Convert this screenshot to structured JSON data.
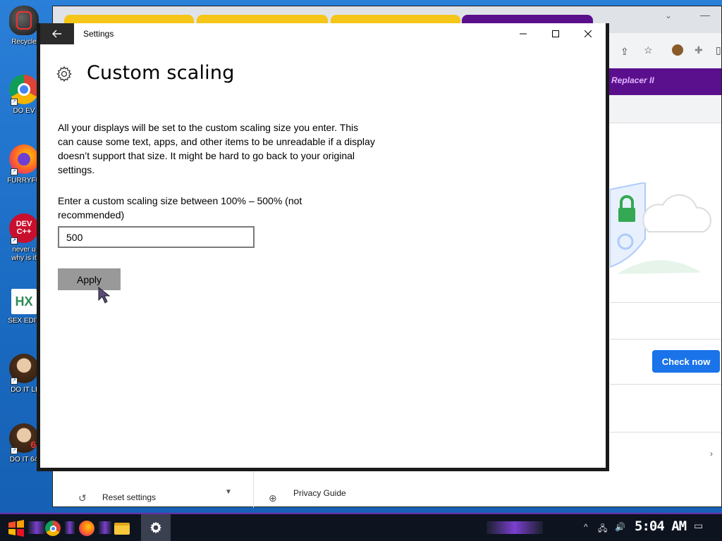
{
  "desktop": {
    "icons": [
      {
        "label": "Recycle",
        "icon": "recycle-bin-icon"
      },
      {
        "label": "DO EV",
        "icon": "chrome-icon"
      },
      {
        "label": "FURRYFU",
        "icon": "firefox-icon"
      },
      {
        "label": "never u",
        "label2": "why is it",
        "icon": "devcpp-icon",
        "art": "DEV C++"
      },
      {
        "label": "SEX EDIT",
        "icon": "hex-editor-icon",
        "art": "HX"
      },
      {
        "label": "DO IT LI",
        "icon": "portrait-icon"
      },
      {
        "label": "DO IT 64",
        "icon": "portrait-icon",
        "art": "64"
      }
    ]
  },
  "browser": {
    "bookmark_text": "Replacer II",
    "check_now": "Check now",
    "privacy_guide": "Privacy Guide",
    "reset_settings": "Reset settings",
    "accent": "#1a73e8",
    "bookmark_bar_color": "#5a0f8c"
  },
  "window": {
    "title": "Settings",
    "back_icon": "back-arrow-icon",
    "minimize_icon": "minimize-icon",
    "maximize_icon": "maximize-icon",
    "close_icon": "close-icon"
  },
  "page": {
    "title": "Custom scaling",
    "description": "All your displays will be set to the custom scaling size you enter. This can cause some text, apps, and other items to be unreadable if a display doesn’t support that size. It might be hard to go back to your original settings.",
    "prompt": "Enter a custom scaling size between 100% – 500% (not recommended)",
    "input_value": "500",
    "apply_label": "Apply"
  },
  "taskbar": {
    "clock": "5:04 AM",
    "items": [
      "start-icon",
      "chrome-icon",
      "firefox-icon",
      "file-explorer-icon",
      "settings-gear-icon"
    ],
    "tray": [
      "chevron-up-icon",
      "network-icon",
      "volume-icon",
      "notification-icon"
    ]
  }
}
